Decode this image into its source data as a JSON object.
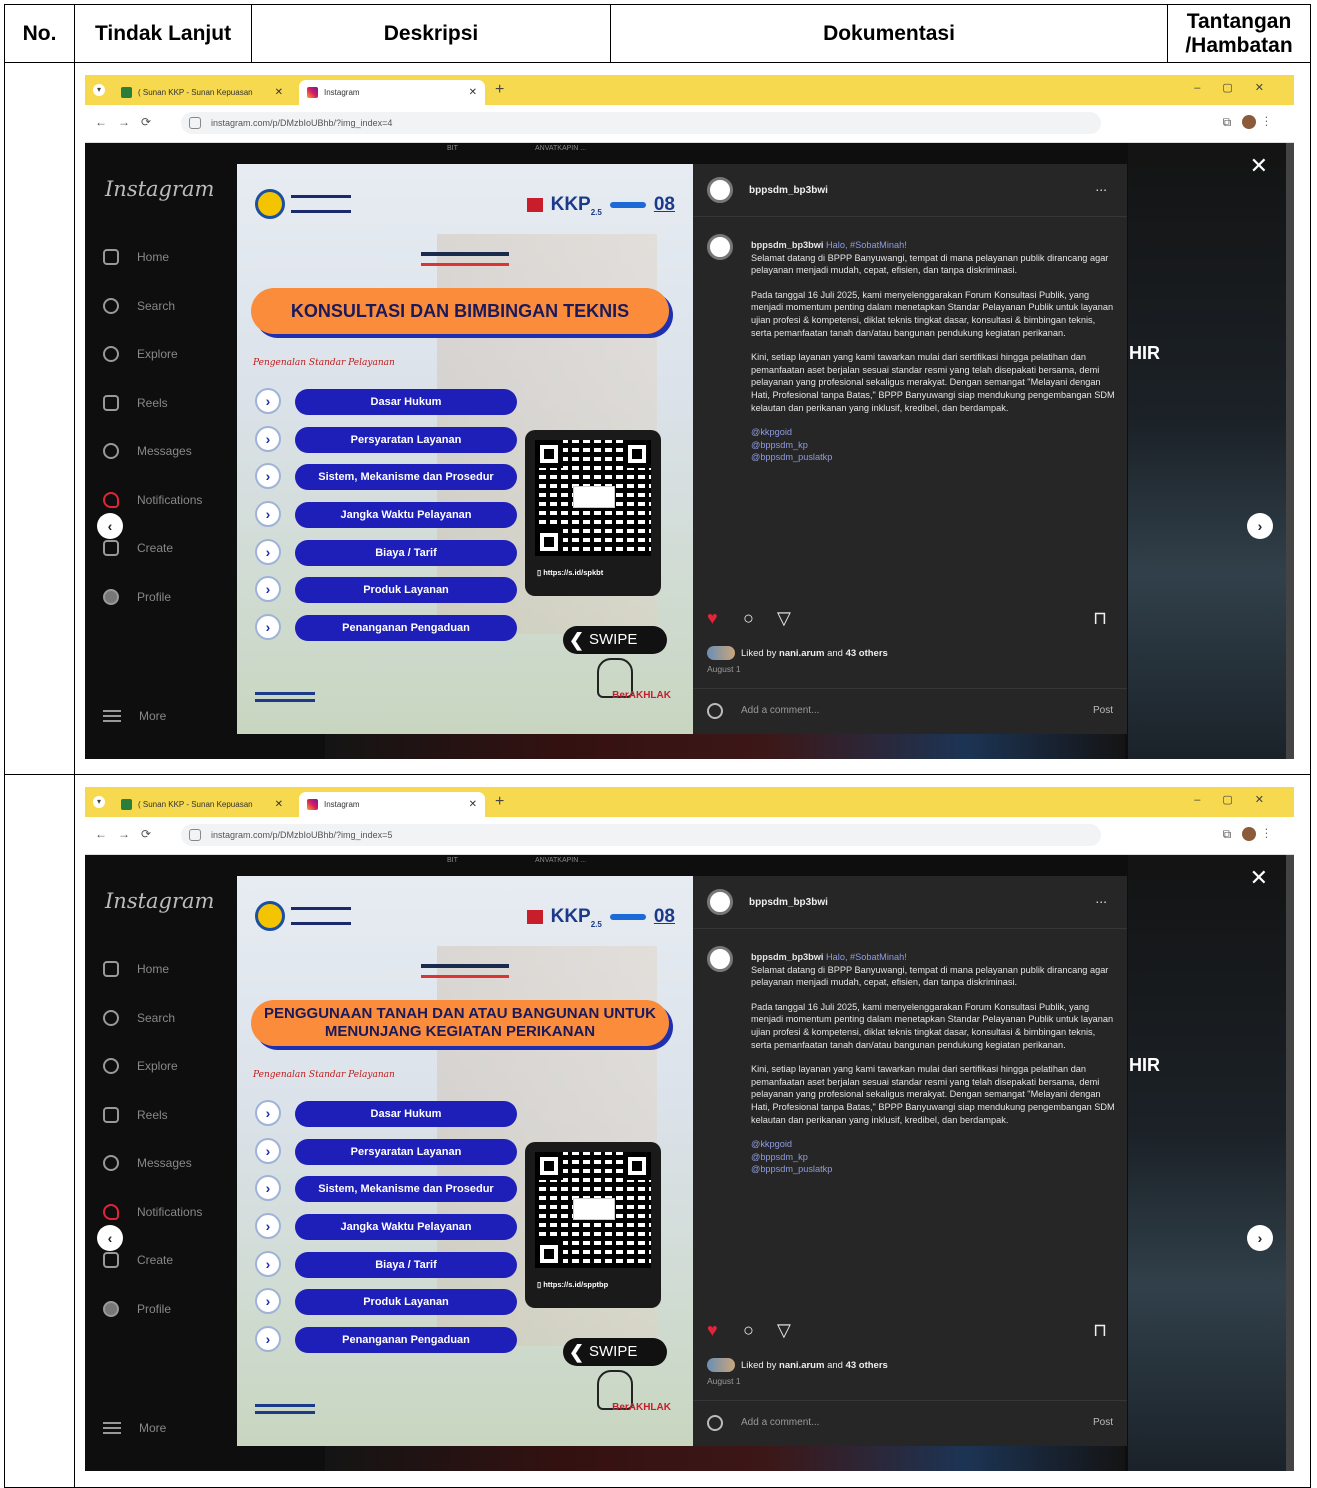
{
  "table": {
    "headers": [
      "No.",
      "Tindak Lanjut",
      "Deskripsi",
      "Dokumentasi",
      "Tantangan /Hambatan"
    ]
  },
  "browser": {
    "tab1_title": "( Sunan KKP - Sunan Kepuasan",
    "tab2_title": "Instagram",
    "newtab": "+",
    "url1": "instagram.com/p/DMzbIoUBhb/?img_index=4",
    "url2": "instagram.com/p/DMzbIoUBhb/?img_index=5"
  },
  "instagram": {
    "logo": "Instagram",
    "nav": [
      "Home",
      "Search",
      "Explore",
      "Reels",
      "Messages",
      "Notifications",
      "Create",
      "Profile"
    ],
    "more": "More",
    "top_left": "BIT",
    "top_right": "ANVATKAPIN ..."
  },
  "poster": {
    "banner1": "KONSULTASI DAN BIMBINGAN TEKNIS",
    "banner2": "PENGGUNAAN TANAH DAN ATAU BANGUNAN UNTUK MENUNJANG KEGIATAN PERIKANAN",
    "script": "Pengenalan Standar Pelayanan",
    "services": [
      "Dasar Hukum",
      "Persyaratan Layanan",
      "Sistem, Mekanisme dan Prosedur",
      "Jangka Waktu Pelayanan",
      "Biaya / Tarif",
      "Produk Layanan",
      "Penanganan Pengaduan"
    ],
    "qr_link1": "https://s.id/spkbt",
    "qr_link2": "https://s.id/spptbp",
    "swipe": "SWIPE",
    "kkp": "KKP",
    "kkp_small": "2.5",
    "eight": "08",
    "berakhlak": "BerAKHLAK"
  },
  "post": {
    "username": "bppsdm_bp3bwi",
    "caption_intro": "Halo, #SobatMinah!",
    "caption_p1": "Selamat datang di BPPP Banyuwangi, tempat di mana pelayanan publik dirancang agar pelayanan menjadi mudah, cepat, efisien, dan tanpa diskriminasi.",
    "caption_p2": "Pada tanggal 16 Juli 2025, kami menyelenggarakan Forum Konsultasi Publik, yang menjadi momentum penting dalam menetapkan Standar Pelayanan Publik untuk layanan ujian profesi & kompetensi, diklat teknis tingkat dasar, konsultasi & bimbingan teknis, serta pemanfaatan tanah dan/atau bangunan pendukung kegiatan perikanan.",
    "caption_p3": "Kini, setiap layanan yang kami tawarkan mulai dari sertifikasi hingga pelatihan dan pemanfaatan aset berjalan sesuai standar resmi yang telah disepakati bersama, demi pelayanan yang profesional sekaligus merakyat. Dengan semangat \"Melayani dengan Hati, Profesional tanpa Batas,\" BPPP Banyuwangi siap mendukung pengembangan SDM kelautan dan perikanan yang inklusif, kredibel, dan berdampak.",
    "tags": [
      "@kkpgoid",
      "@bppsdm_kp",
      "@bppsdm_puslatkp"
    ],
    "likes_prefix": "Liked by",
    "likes_user": "nani.arum",
    "likes_and": "and",
    "likes_count": "43 others",
    "date": "August 1",
    "comment_placeholder": "Add a comment...",
    "post_button": "Post",
    "dots": "...",
    "side_hint": "HIR"
  }
}
